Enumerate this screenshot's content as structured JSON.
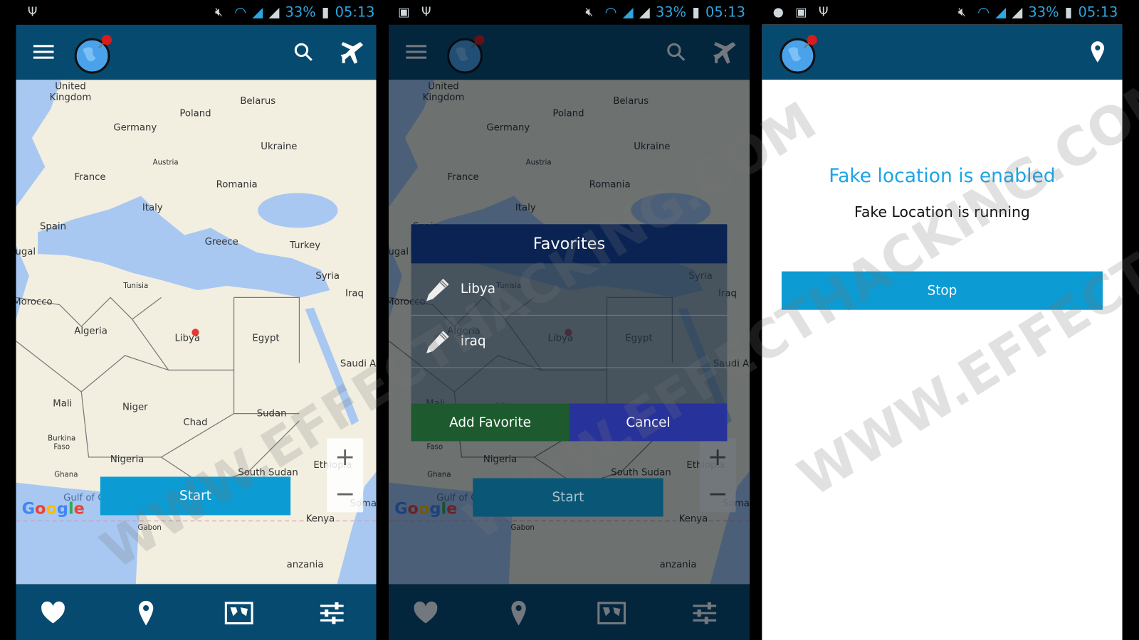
{
  "status_bar": {
    "battery": "33%",
    "time": "05:13",
    "icons": [
      "usb-icon",
      "mute-icon",
      "wifi-icon",
      "signal-icon",
      "signal-no-sim-icon",
      "battery-charging-icon"
    ]
  },
  "watermark": "WWW.EFFECTHACKING.COM",
  "map": {
    "labels": [
      "United",
      "Kingdom",
      "Poland",
      "Belarus",
      "Germany",
      "Ukraine",
      "Austria",
      "France",
      "Romania",
      "Italy",
      "Spain",
      "Greece",
      "Turkey",
      "ugal",
      "Tunisia",
      "Syria",
      "Iraq",
      "Morocco",
      "Algeria",
      "Libya",
      "Egypt",
      "Saudi A",
      "Mali",
      "Niger",
      "Chad",
      "Sudan",
      "Burkina",
      "Faso",
      "Nigeria",
      "Ethiopia",
      "South Sudan",
      "Ghana",
      "Gulf of Guinea",
      "Kenya",
      "Gabon",
      "anzania",
      "Soma"
    ],
    "google_logo": "Google",
    "zoom_in": "+",
    "zoom_out": "−",
    "marker_color": "#e53935",
    "sea_color": "#a8c8f2"
  },
  "screen1": {
    "start_label": "Start"
  },
  "screen2": {
    "start_label": "Start",
    "dialog": {
      "title": "Favorites",
      "items": [
        {
          "name": "Libya"
        },
        {
          "name": "iraq"
        }
      ],
      "add_label": "Add Favorite",
      "cancel_label": "Cancel"
    }
  },
  "screen3": {
    "title": "Fake location is enabled",
    "subtitle": "Fake Location is running",
    "stop_label": "Stop"
  },
  "colors": {
    "appbar": "#074a70",
    "accent": "#0c9bd3",
    "dialog_header": "#0a2352",
    "add": "#1d5a2e",
    "cancel": "#27339a"
  }
}
